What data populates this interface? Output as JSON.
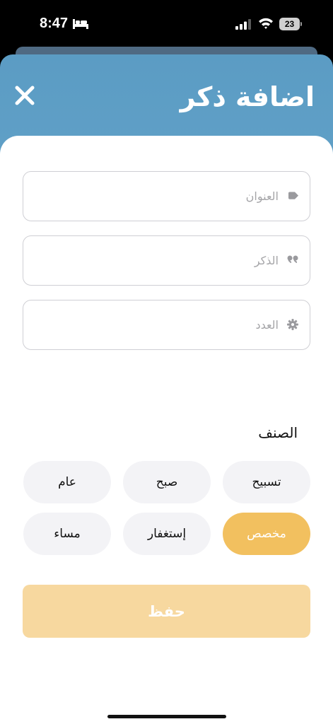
{
  "status_bar": {
    "time": "8:47",
    "battery_level": "23",
    "icons": [
      "bed-icon",
      "signal-icon",
      "wifi-icon",
      "battery-icon"
    ]
  },
  "header": {
    "title": "اضافة ذكر",
    "close_icon": "close-icon"
  },
  "form": {
    "fields": [
      {
        "placeholder": "العنوان",
        "value": "",
        "icon": "tag-icon"
      },
      {
        "placeholder": "الذكر",
        "value": "",
        "icon": "quote-icon"
      },
      {
        "placeholder": "العدد",
        "value": "",
        "icon": "gear-icon"
      }
    ],
    "category_label": "الصنف",
    "categories": [
      {
        "label": "تسبيح",
        "selected": false
      },
      {
        "label": "صبح",
        "selected": false
      },
      {
        "label": "عام",
        "selected": false
      },
      {
        "label": "مخصص",
        "selected": true
      },
      {
        "label": "إستغفار",
        "selected": false
      },
      {
        "label": "مساء",
        "selected": false
      }
    ],
    "save_label": "حفظ"
  },
  "colors": {
    "header_gradient_top": "#5b9cc4",
    "header_gradient_bottom": "#79b3d3",
    "selected_chip": "#f2c05f",
    "save_button": "#f7d89f",
    "chip_background": "#f3f3f6"
  }
}
